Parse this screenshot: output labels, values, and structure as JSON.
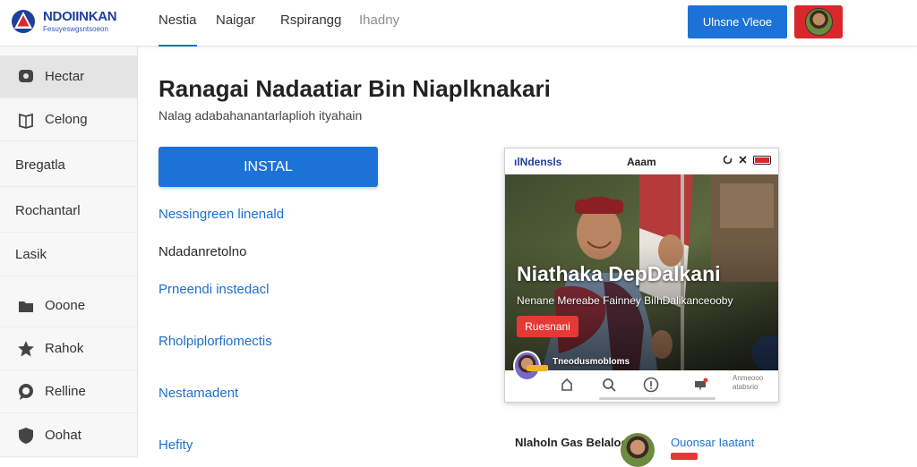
{
  "header": {
    "brand_name": "NDOIINKAN",
    "brand_tagline": "Fesuyeswgsntsoeon",
    "tabs": [
      {
        "label": "Nestia",
        "active": true
      },
      {
        "label": "Naigar",
        "active": false
      },
      {
        "label": "Rspirangg",
        "active": false
      },
      {
        "label": "Ihadny",
        "active": false
      }
    ],
    "cta_label": "Ulnsne Vleoe"
  },
  "sidebar": {
    "items": [
      {
        "label": "Hectar",
        "icon": "chat-icon",
        "active": true
      },
      {
        "label": "Celong",
        "icon": "book-icon",
        "active": false
      },
      {
        "label": "Bregatla",
        "icon": "",
        "active": false
      },
      {
        "label": "Rochantarl",
        "icon": "",
        "active": false
      },
      {
        "label": "Lasik",
        "icon": "",
        "active": false
      },
      {
        "label": "Ooone",
        "icon": "folder-icon",
        "active": false
      },
      {
        "label": "Rahok",
        "icon": "star-icon",
        "active": false
      },
      {
        "label": "Relline",
        "icon": "message-icon",
        "active": false
      },
      {
        "label": "Oohat",
        "icon": "shield-icon",
        "active": false
      }
    ]
  },
  "main": {
    "title": "Ranagai Nadaatiar Bin Niaplknakari",
    "subtitle": "Nalag adabahanantarlaplioh ityahain",
    "install_label": "INSTAL",
    "links": [
      "Nessingreen linenald",
      "Ndadanretolno",
      "Prneendi instedacl",
      "Rholpiplorfiomectis",
      "Nestamadent",
      "Hefity"
    ]
  },
  "phone": {
    "status_left": "ılNdensls",
    "status_center": "Aaam",
    "headline": "Niathaka DepDalkani",
    "caption": "Nenane Mereabe Fainney BiIhDalikanceooby",
    "badge_label": "Ruesnani",
    "username": "Tneodusmobloms",
    "nav_label": "Anmeooo atabsrio"
  },
  "bottom": {
    "card_text": "Nlaholn Gas Belaloon",
    "card_link": "Ouonsar Iaatant"
  },
  "colors": {
    "primary": "#1c72d6",
    "link": "#1c6fd0",
    "danger": "#e53935",
    "brand_navy": "#1f3f9a"
  }
}
